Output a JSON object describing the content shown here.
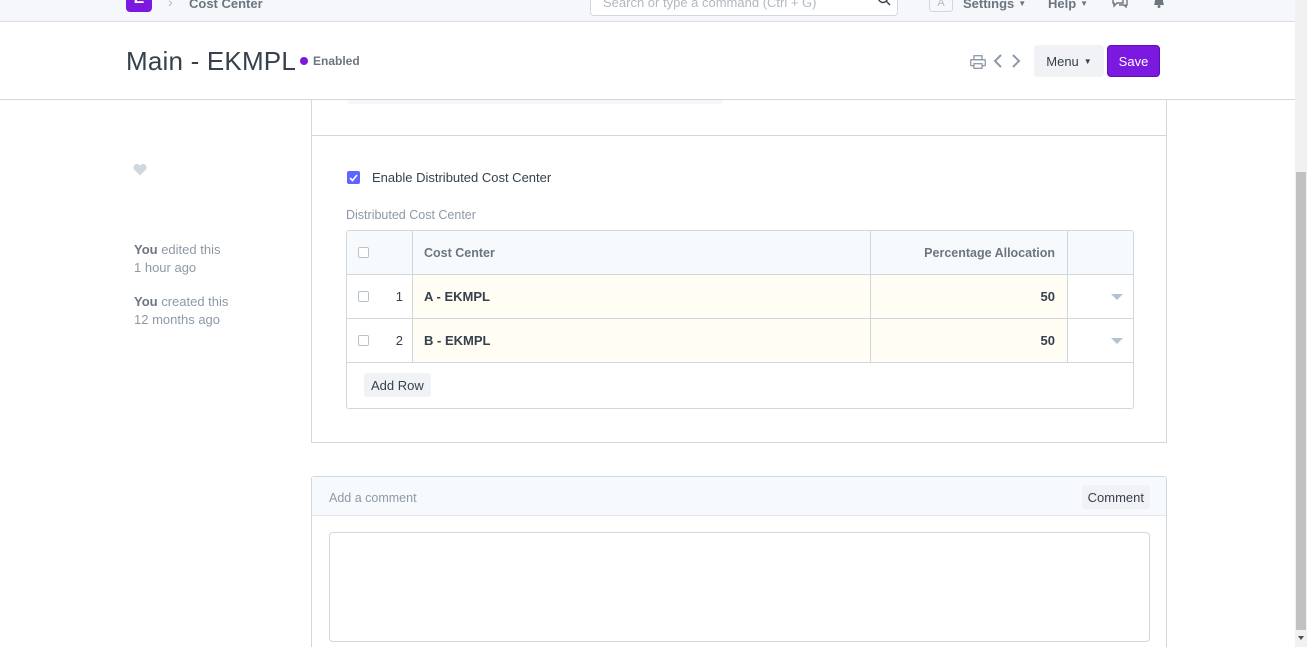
{
  "navbar": {
    "logo_letter": "E",
    "breadcrumb": "Cost Center",
    "search_placeholder": "Search or type a command (Ctrl + G)",
    "avatar_letter": "A",
    "settings_label": "Settings",
    "help_label": "Help"
  },
  "header": {
    "title": "Main - EKMPL",
    "status": "Enabled",
    "menu_label": "Menu",
    "save_label": "Save"
  },
  "sidebar": {
    "timeline": [
      {
        "actor": "You",
        "action": " edited this",
        "when": "1 hour ago"
      },
      {
        "actor": "You",
        "action": " created this",
        "when": "12 months ago"
      }
    ]
  },
  "form": {
    "enable_dcc_label": "Enable Distributed Cost Center",
    "enable_dcc_checked": true,
    "grid_label": "Distributed Cost Center",
    "grid": {
      "columns": [
        "Cost Center",
        "Percentage Allocation"
      ],
      "rows": [
        {
          "idx": "1",
          "cost_center": "A - EKMPL",
          "percentage": "50"
        },
        {
          "idx": "2",
          "cost_center": "B - EKMPL",
          "percentage": "50"
        }
      ],
      "add_row_label": "Add Row"
    }
  },
  "comment": {
    "placeholder": "Add a comment",
    "button_label": "Comment"
  },
  "colors": {
    "accent": "#7c19e0",
    "checkbox": "#5e64ff",
    "editable_cell_bg": "#fffdf4"
  }
}
